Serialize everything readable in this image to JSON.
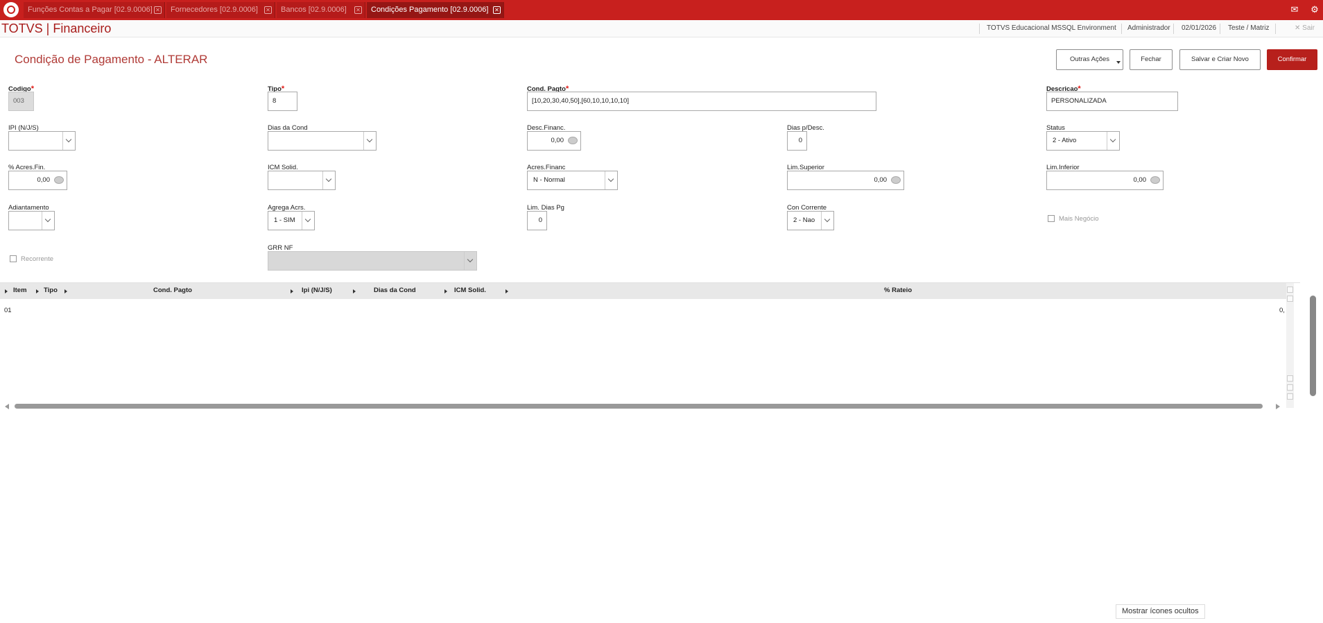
{
  "tabs": [
    {
      "label": "Funções Contas a Pagar [02.9.0006]",
      "active": false
    },
    {
      "label": "Fornecedores [02.9.0006]",
      "active": false
    },
    {
      "label": "Bancos [02.9.0006]",
      "active": false
    },
    {
      "label": "Condições Pagamento [02.9.0006]",
      "active": true
    }
  ],
  "app": {
    "title": "TOTVS | Financeiro",
    "environment": "TOTVS Educacional MSSQL Environment",
    "user": "Administrador",
    "date": "02/01/2026",
    "branch": "Teste / Matriz",
    "logout": "Sair"
  },
  "page": {
    "title": "Condição de Pagamento - ALTERAR"
  },
  "buttons": {
    "outras_acoes": "Outras Ações",
    "fechar": "Fechar",
    "salvar_criar_novo": "Salvar e Criar Novo",
    "confirmar": "Confirmar"
  },
  "fields": {
    "codigo": {
      "label": "Codigo",
      "value": "003"
    },
    "tipo": {
      "label": "Tipo",
      "value": "8"
    },
    "cond_pagto": {
      "label": "Cond. Pagto",
      "value": "[10,20,30,40,50],[60,10,10,10,10]"
    },
    "descricao": {
      "label": "Descricao",
      "value": "PERSONALIZADA"
    },
    "ipi": {
      "label": "IPI (N/J/S)",
      "value": ""
    },
    "dias_cond": {
      "label": "Dias da Cond",
      "value": ""
    },
    "desc_financ": {
      "label": "Desc.Financ.",
      "value": "0,00"
    },
    "dias_p_desc": {
      "label": "Dias p/Desc.",
      "value": "0"
    },
    "status": {
      "label": "Status",
      "value": "2 - Ativo"
    },
    "acres_fin": {
      "label": "% Acres.Fin.",
      "value": "0,00"
    },
    "icm_solid": {
      "label": "ICM Solid.",
      "value": ""
    },
    "acres_financ": {
      "label": "Acres.Financ",
      "value": "N - Normal"
    },
    "lim_superior": {
      "label": "Lim.Superior",
      "value": "0,00"
    },
    "lim_inferior": {
      "label": "Lim.Inferior",
      "value": "0,00"
    },
    "adiantamento": {
      "label": "Adiantamento",
      "value": ""
    },
    "agrega_acrs": {
      "label": "Agrega Acrs.",
      "value": "1 - SIM"
    },
    "lim_dias_pg": {
      "label": "Lim. Dias Pg",
      "value": "0"
    },
    "con_corrente": {
      "label": "Con Corrente",
      "value": "2 - Nao"
    },
    "mais_negocio": {
      "label": "Mais Negócio"
    },
    "recorrente": {
      "label": "Recorrente"
    },
    "grr_nf": {
      "label": "GRR NF",
      "value": ""
    }
  },
  "grid": {
    "columns": [
      "Item",
      "Tipo",
      "Cond. Pagto",
      "Ipi (N/J/S)",
      "Dias da Cond",
      "ICM Solid.",
      "% Rateio"
    ],
    "rows": [
      {
        "item": "01",
        "rateio": "0,"
      }
    ]
  },
  "tooltip": "Mostrar ícones ocultos",
  "colors": {
    "brand_red": "#c8201e",
    "primary_button": "#b7201c",
    "title_red": "#b03a36"
  }
}
